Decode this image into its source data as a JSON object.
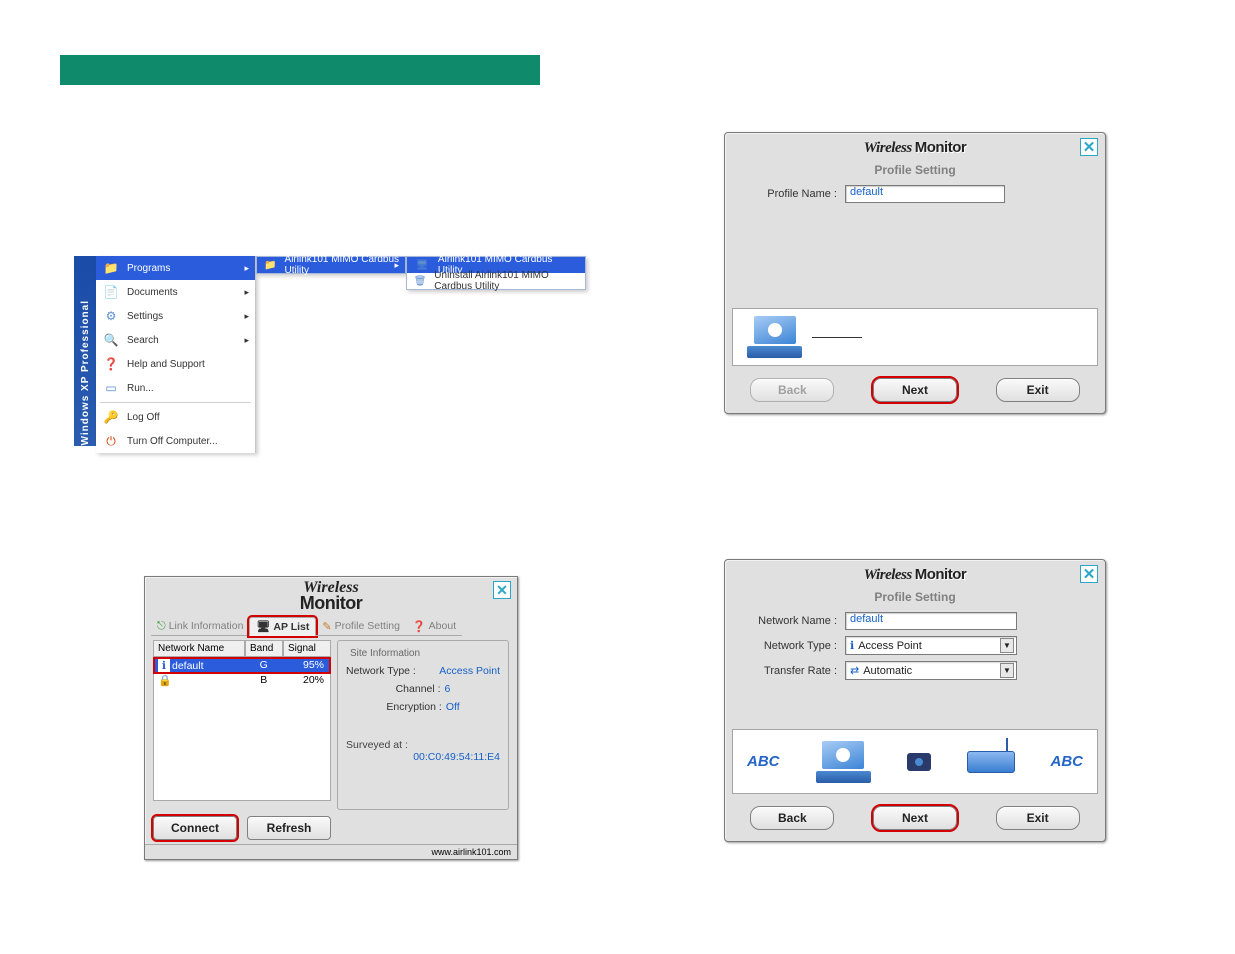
{
  "colors": {
    "green": "#0f8a6b",
    "highlight_blue": "#2a5cdc",
    "link_blue": "#1560c8",
    "ring_red": "#d20000"
  },
  "startMenu": {
    "osLabel": "Windows XP  Professional",
    "main": [
      {
        "icon": "programs-icon",
        "label": "Programs",
        "arrow": true,
        "highlight": true
      },
      {
        "icon": "documents-icon",
        "label": "Documents",
        "arrow": true
      },
      {
        "icon": "settings-icon",
        "label": "Settings",
        "arrow": true
      },
      {
        "icon": "search-icon",
        "label": "Search",
        "arrow": true
      },
      {
        "icon": "help-icon",
        "label": "Help and Support"
      },
      {
        "icon": "run-icon",
        "label": "Run..."
      },
      {
        "divider": true
      },
      {
        "icon": "logoff-icon",
        "label": "Log Off"
      },
      {
        "icon": "shutdown-icon",
        "label": "Turn Off Computer..."
      }
    ],
    "sub1": {
      "icon": "folder-icon",
      "label": "Airlink101 MIMO Cardbus Utility",
      "arrow": true,
      "highlight": true
    },
    "sub2": [
      {
        "icon": "app-icon",
        "label": "Airlink101 MIMO Cardbus Utility",
        "highlight": true
      },
      {
        "icon": "uninstall-icon",
        "label": "Uninstall Airlink101 MIMO Cardbus Utility"
      }
    ]
  },
  "wm1": {
    "brand": {
      "w1": "Wireless",
      "w2": "Monitor"
    },
    "subtitle": "Profile Setting",
    "profileNameLabel": "Profile Name :",
    "profileNameValue": "default",
    "buttons": {
      "back": "Back",
      "next": "Next",
      "exit": "Exit"
    }
  },
  "wm2": {
    "brand": {
      "w1": "Wireless",
      "w2": "Monitor"
    },
    "subtitle": "Profile Setting",
    "networkNameLabel": "Network Name :",
    "networkNameValue": "default",
    "networkTypeLabel": "Network Type :",
    "networkTypeValue": "Access Point",
    "transferRateLabel": "Transfer Rate :",
    "transferRateValue": "Automatic",
    "abcLabel": "ABC",
    "buttons": {
      "back": "Back",
      "next": "Next",
      "exit": "Exit"
    }
  },
  "ap": {
    "brand": {
      "w1": "Wireless",
      "w2": "Monitor"
    },
    "tabs": {
      "linkInfo": "Link Information",
      "apList": "AP List",
      "profileSetting": "Profile Setting",
      "about": "About"
    },
    "cols": {
      "name": "Network Name",
      "band": "Band",
      "signal": "Signal"
    },
    "rows": [
      {
        "name": "default",
        "band": "G",
        "signal": "95%",
        "selected": true,
        "icon": "info"
      },
      {
        "name": "",
        "band": "B",
        "signal": "20%",
        "selected": false,
        "icon": "lock"
      }
    ],
    "siteInfo": {
      "legend": "Site Information",
      "netTypeLabel": "Network Type :",
      "netTypeValue": "Access Point",
      "channelLabel": "Channel :",
      "channelValue": "6",
      "encLabel": "Encryption :",
      "encValue": "Off",
      "surveyedLabel": "Surveyed at :",
      "surveyedValue": "00:C0:49:54:11:E4"
    },
    "buttons": {
      "connect": "Connect",
      "refresh": "Refresh"
    },
    "footerUrl": "www.airlink101.com"
  }
}
